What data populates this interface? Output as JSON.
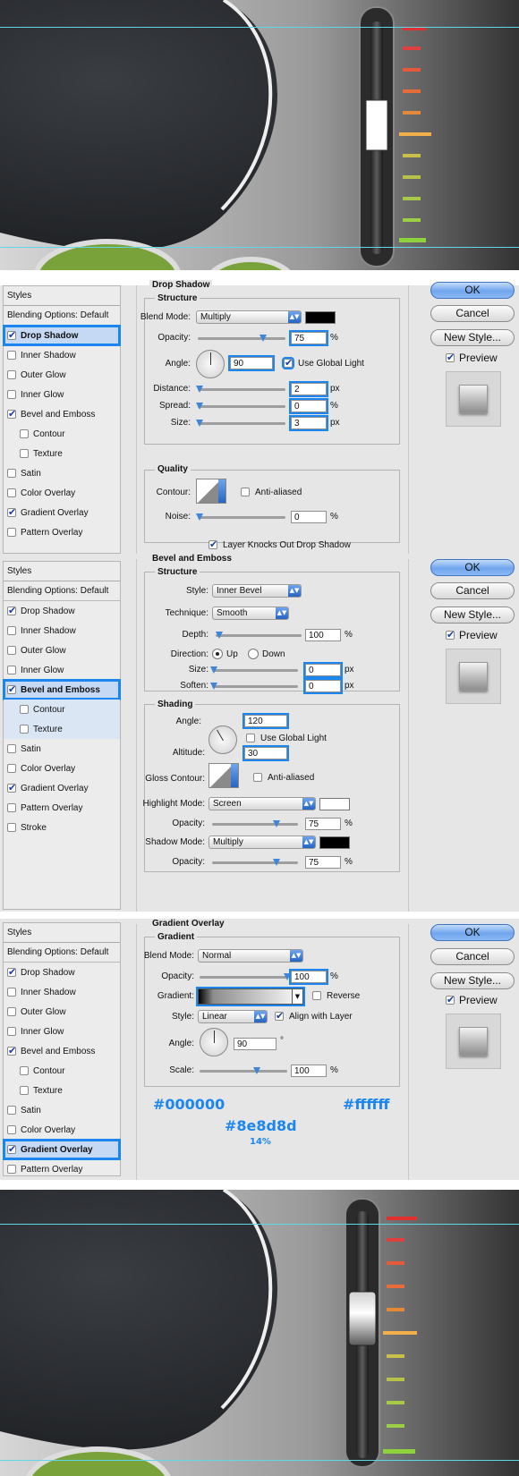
{
  "art_top": {
    "guides": 2
  },
  "sidebar": {
    "title": "Styles",
    "blending": "Blending Options: Default",
    "items": [
      "Drop Shadow",
      "Inner Shadow",
      "Outer Glow",
      "Inner Glow",
      "Bevel and Emboss",
      "Contour",
      "Texture",
      "Satin",
      "Color Overlay",
      "Gradient Overlay",
      "Pattern Overlay",
      "Stroke"
    ]
  },
  "buttons": {
    "ok": "OK",
    "cancel": "Cancel",
    "new_style": "New Style...",
    "preview": "Preview"
  },
  "drop_shadow": {
    "title": "Drop Shadow",
    "structure": "Structure",
    "blend_mode_label": "Blend Mode:",
    "blend_mode": "Multiply",
    "blend_color": "#000000",
    "opacity_label": "Opacity:",
    "opacity": "75",
    "opacity_pct": 0.75,
    "angle_label": "Angle:",
    "angle": "90",
    "use_global_light": "Use Global Light",
    "distance_label": "Distance:",
    "distance": "2",
    "spread_label": "Spread:",
    "spread": "0",
    "size_label": "Size:",
    "size": "3",
    "quality": "Quality",
    "contour_label": "Contour:",
    "anti_aliased": "Anti-aliased",
    "noise_label": "Noise:",
    "noise": "0",
    "knockout": "Layer Knocks Out Drop Shadow",
    "px": "px",
    "pct": "%"
  },
  "bevel": {
    "title": "Bevel and Emboss",
    "structure": "Structure",
    "style_label": "Style:",
    "style": "Inner Bevel",
    "technique_label": "Technique:",
    "technique": "Smooth",
    "depth_label": "Depth:",
    "depth": "100",
    "direction_label": "Direction:",
    "up": "Up",
    "down": "Down",
    "size_label": "Size:",
    "size": "0",
    "soften_label": "Soften:",
    "soften": "0",
    "shading": "Shading",
    "angle_label": "Angle:",
    "angle": "120",
    "use_global_light": "Use Global Light",
    "altitude_label": "Altitude:",
    "altitude": "30",
    "gloss_label": "Gloss Contour:",
    "anti_aliased": "Anti-aliased",
    "highlight_label": "Highlight Mode:",
    "highlight_mode": "Screen",
    "highlight_color": "#ffffff",
    "hl_opacity_label": "Opacity:",
    "hl_opacity": "75",
    "shadow_label": "Shadow Mode:",
    "shadow_mode": "Multiply",
    "shadow_color": "#000000",
    "sh_opacity_label": "Opacity:",
    "sh_opacity": "75",
    "px": "px",
    "pct": "%"
  },
  "gradient": {
    "title": "Gradient Overlay",
    "group": "Gradient",
    "blend_mode_label": "Blend Mode:",
    "blend_mode": "Normal",
    "opacity_label": "Opacity:",
    "opacity": "100",
    "gradient_label": "Gradient:",
    "reverse": "Reverse",
    "style_label": "Style:",
    "style": "Linear",
    "align": "Align with Layer",
    "angle_label": "Angle:",
    "angle": "90",
    "scale_label": "Scale:",
    "scale": "100",
    "pct": "%",
    "color_start": "#000000",
    "color_end": "#ffffff",
    "color_mid": "#8e8d8d",
    "mid_location": "14%"
  }
}
